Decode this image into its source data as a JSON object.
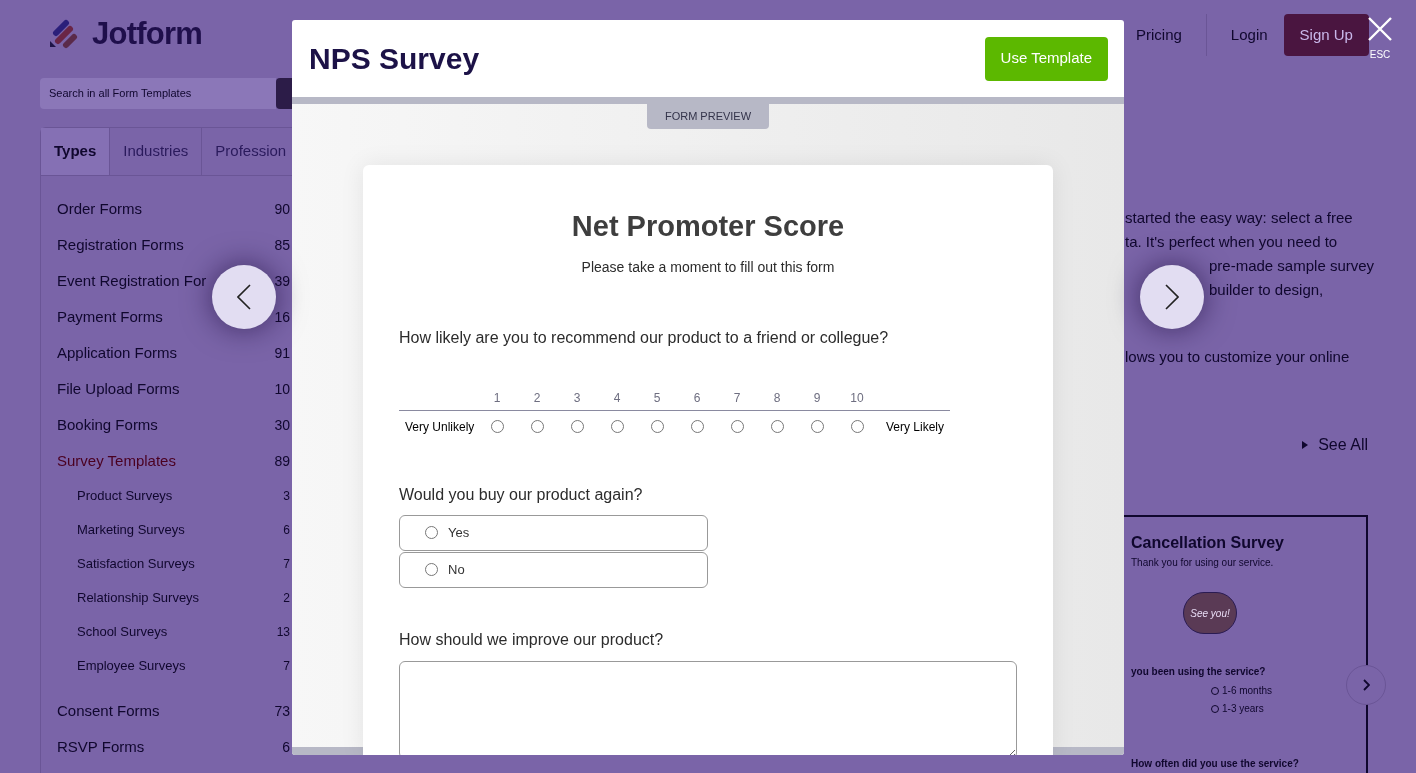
{
  "logo": {
    "text": "Jotform"
  },
  "nav": [
    {
      "label": "Pricing",
      "kind": "link"
    },
    {
      "label": "Login",
      "kind": "link"
    },
    {
      "label": "Sign Up",
      "kind": "button"
    }
  ],
  "close": {
    "label": "ESC"
  },
  "sidebar": {
    "search": {
      "placeholder": "Search in all Form Templates"
    },
    "tabs": [
      {
        "label": "Types",
        "selected": true
      },
      {
        "label": "Industries",
        "selected": false
      },
      {
        "label": "Profession",
        "selected": false
      }
    ],
    "categories": [
      {
        "label": "Order Forms",
        "count": "90",
        "selected": false
      },
      {
        "label": "Registration Forms",
        "count": "85",
        "selected": false
      },
      {
        "label": "Event Registration For",
        "count": "39",
        "selected": false
      },
      {
        "label": "Payment Forms",
        "count": "16",
        "selected": false
      },
      {
        "label": "Application Forms",
        "count": "91",
        "selected": false
      },
      {
        "label": "File Upload Forms",
        "count": "10",
        "selected": false
      },
      {
        "label": "Booking Forms",
        "count": "30",
        "selected": false
      },
      {
        "label": "Survey Templates",
        "count": "89",
        "selected": true,
        "children": [
          {
            "label": "Product Surveys",
            "count": "3",
            "selected": false
          },
          {
            "label": "Marketing Surveys",
            "count": "6",
            "selected": false
          },
          {
            "label": "Satisfaction Surveys",
            "count": "7",
            "selected": false
          },
          {
            "label": "Relationship Surveys",
            "count": "2",
            "selected": false
          },
          {
            "label": "School Surveys",
            "count": "13",
            "selected": false
          },
          {
            "label": "Employee Surveys",
            "count": "7",
            "selected": false
          }
        ]
      },
      {
        "label": "Consent Forms",
        "count": "73",
        "selected": false
      },
      {
        "label": "RSVP Forms",
        "count": "6",
        "selected": false
      }
    ]
  },
  "content": {
    "paragraph_top": [
      "started the easy way: select a free",
      "ta. It's perfect when you need to"
    ],
    "paragraph_beside_arrow": [
      "pre-made sample survey",
      "builder to design,"
    ],
    "paragraph_bottom": [
      "lows you to customize your online"
    ],
    "see_all": "See All",
    "template_card": {
      "title": "Cancellation Survey",
      "subtitle": "Thank you for using our service.",
      "bubble_text": "See you!",
      "question_1": "you been using the service?",
      "options": [
        "1-6 months",
        "1-3 years"
      ],
      "question_2": "How often did you use the service?"
    }
  },
  "modal": {
    "title": "NPS Survey",
    "use_button": "Use Template",
    "preview_label": "FORM PREVIEW",
    "form": {
      "title": "Net Promoter Score",
      "subtitle": "Please take a moment to fill out this form",
      "questions": [
        {
          "kind": "scale",
          "label": "How likely are you to recommend our product to a friend or collegue?",
          "low_label": "Very Unlikely",
          "high_label": "Very Likely",
          "options": [
            {
              "label": "1",
              "selected": false
            },
            {
              "label": "2",
              "selected": false
            },
            {
              "label": "3",
              "selected": false
            },
            {
              "label": "4",
              "selected": false
            },
            {
              "label": "5",
              "selected": false
            },
            {
              "label": "6",
              "selected": false
            },
            {
              "label": "7",
              "selected": false
            },
            {
              "label": "8",
              "selected": false
            },
            {
              "label": "9",
              "selected": false
            },
            {
              "label": "10",
              "selected": false
            }
          ]
        },
        {
          "kind": "radio",
          "label": "Would you buy our product again?",
          "options": [
            {
              "label": "Yes",
              "selected": false
            },
            {
              "label": "No",
              "selected": false
            }
          ]
        },
        {
          "kind": "textarea",
          "label": "How should we improve our product?"
        }
      ]
    }
  }
}
